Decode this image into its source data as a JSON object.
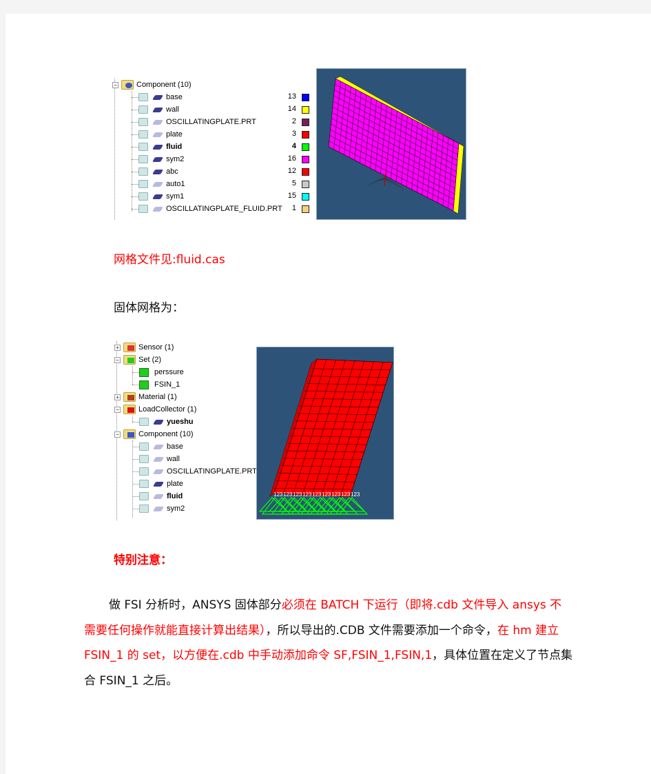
{
  "figure1": {
    "tree": {
      "root": {
        "label": "Component (10)",
        "expanded": true
      },
      "items": [
        {
          "label": "base",
          "count": "13",
          "color": "#0000ff",
          "active": true,
          "bold": false
        },
        {
          "label": "wall",
          "count": "14",
          "color": "#ffff00",
          "active": true,
          "bold": false
        },
        {
          "label": "OSCILLATINGPLATE.PRT",
          "count": "2",
          "color": "#7a1f55",
          "active": false,
          "bold": false
        },
        {
          "label": "plate",
          "count": "3",
          "color": "#ff0000",
          "active": false,
          "bold": false
        },
        {
          "label": "fluid",
          "count": "4",
          "color": "#00ff00",
          "active": true,
          "bold": true
        },
        {
          "label": "sym2",
          "count": "16",
          "color": "#ff00ff",
          "active": true,
          "bold": false
        },
        {
          "label": "abc",
          "count": "12",
          "color": "#ff0000",
          "active": true,
          "bold": false
        },
        {
          "label": "auto1",
          "count": "5",
          "color": "#c8c8c8",
          "active": false,
          "bold": false
        },
        {
          "label": "sym1",
          "count": "15",
          "color": "#00ffff",
          "active": true,
          "bold": false
        },
        {
          "label": "OSCILLATINGPLATE_FLUID.PRT",
          "count": "1",
          "color": "#f3d27a",
          "active": false,
          "bold": false
        }
      ]
    },
    "viewport": {
      "background": "#2e5378",
      "face_color": "#ff00ff",
      "edge_color": "#ffff00"
    }
  },
  "caption_mesh_file": "网格文件见:fluid.cas",
  "caption_solid_mesh": "固体网格为：",
  "figure2": {
    "tree": {
      "groups": [
        {
          "label": "Sensor (1)",
          "expanded": false,
          "icon": "sensor"
        },
        {
          "label": "Set (2)",
          "expanded": true,
          "icon": "set",
          "children": [
            {
              "label": "perssure"
            },
            {
              "label": "FSIN_1"
            }
          ]
        },
        {
          "label": "Material (1)",
          "expanded": false,
          "icon": "material"
        },
        {
          "label": "LoadCollector (1)",
          "expanded": true,
          "icon": "load",
          "children": [
            {
              "label": "yueshu",
              "bold": true,
              "active": true
            }
          ]
        },
        {
          "label": "Component (10)",
          "expanded": true,
          "icon": "component",
          "children": [
            {
              "label": "base",
              "active": false,
              "bold": false
            },
            {
              "label": "wall",
              "active": false,
              "bold": false
            },
            {
              "label": "OSCILLATINGPLATE.PRT",
              "active": false,
              "bold": false
            },
            {
              "label": "plate",
              "active": true,
              "bold": false
            },
            {
              "label": "fluid",
              "active": false,
              "bold": true
            },
            {
              "label": "sym2",
              "active": false,
              "bold": false
            }
          ]
        }
      ]
    },
    "viewport": {
      "background": "#2e5378",
      "face_color": "#ff0000",
      "constraint_color": "#00ff00",
      "constraint_label": "123"
    }
  },
  "note_heading": "特别注意：",
  "note_body": [
    {
      "text": "做 FSI 分析时，ANSYS 固体部分",
      "red": false
    },
    {
      "text": "必须在 BATCH  下运行（即将.cdb 文件导入 ansys 不需要任何操作就能直接计算出结果）",
      "red": true
    },
    {
      "text": "，所以导出的.CDB 文件需要添加一个命令，",
      "red": false
    },
    {
      "text": "在 hm 建立 FSIN_1 的 set，以方便在.cdb 中手动添加命令 SF,FSIN_1,FSIN,1",
      "red": true
    },
    {
      "text": "，具体位置在定义了节点集合 FSIN_1 之后。",
      "red": false
    }
  ]
}
